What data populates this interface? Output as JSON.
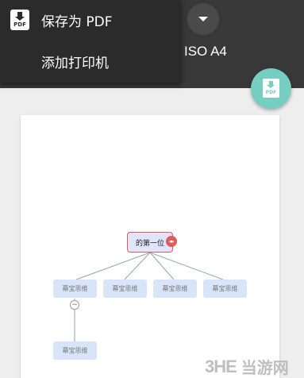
{
  "menu": {
    "save_pdf_label": "保存为 PDF",
    "add_printer_label": "添加打印机",
    "pdf_icon_text": "PDF"
  },
  "toolbar": {
    "paper_size": "ISO A4"
  },
  "fab": {
    "icon_text": "PDF"
  },
  "mindmap": {
    "root_label": "的第一位",
    "children": [
      "幕宝思维",
      "幕宝思维",
      "幕宝思维",
      "幕宝思维"
    ],
    "grandchild": "幕宝思维"
  },
  "watermark": {
    "logo": "3HE",
    "site": "当游网"
  },
  "colors": {
    "topbar": "#383838",
    "menu": "#2b2b2b",
    "fab": "#76cdc1",
    "root_border": "#e05a5a",
    "node_fill": "#d8e4f8"
  }
}
